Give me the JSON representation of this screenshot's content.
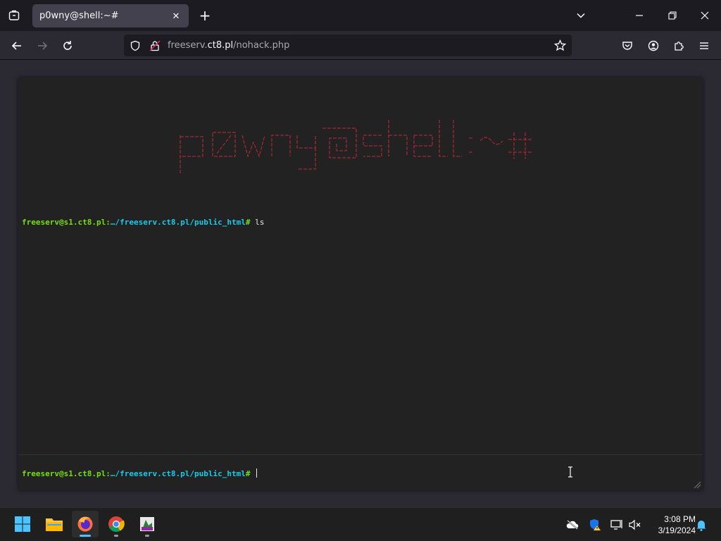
{
  "browser": {
    "tab_title": "p0wny@shell:~#",
    "url_prefix": "freeserv.",
    "url_host": "ct8.pl",
    "url_path": "/nohack.php"
  },
  "shell": {
    "banner_text": "p0wny@shell:~#",
    "history": [
      {
        "user": "freeserv@s1.ct8.pl:",
        "path": "…/freeserv.ct8.pl/public_html",
        "sep": "#",
        "command": " ls"
      }
    ],
    "prompt": {
      "user": "freeserv@s1.ct8.pl:",
      "path": "…/freeserv.ct8.pl/public_html",
      "sep": "# "
    },
    "input_value": ""
  },
  "taskbar": {
    "time": "3:08 PM",
    "date": "3/19/2024"
  },
  "colors": {
    "banner": "#c4263c",
    "prompt_user": "#75df0b",
    "prompt_path": "#1bc9e7"
  }
}
